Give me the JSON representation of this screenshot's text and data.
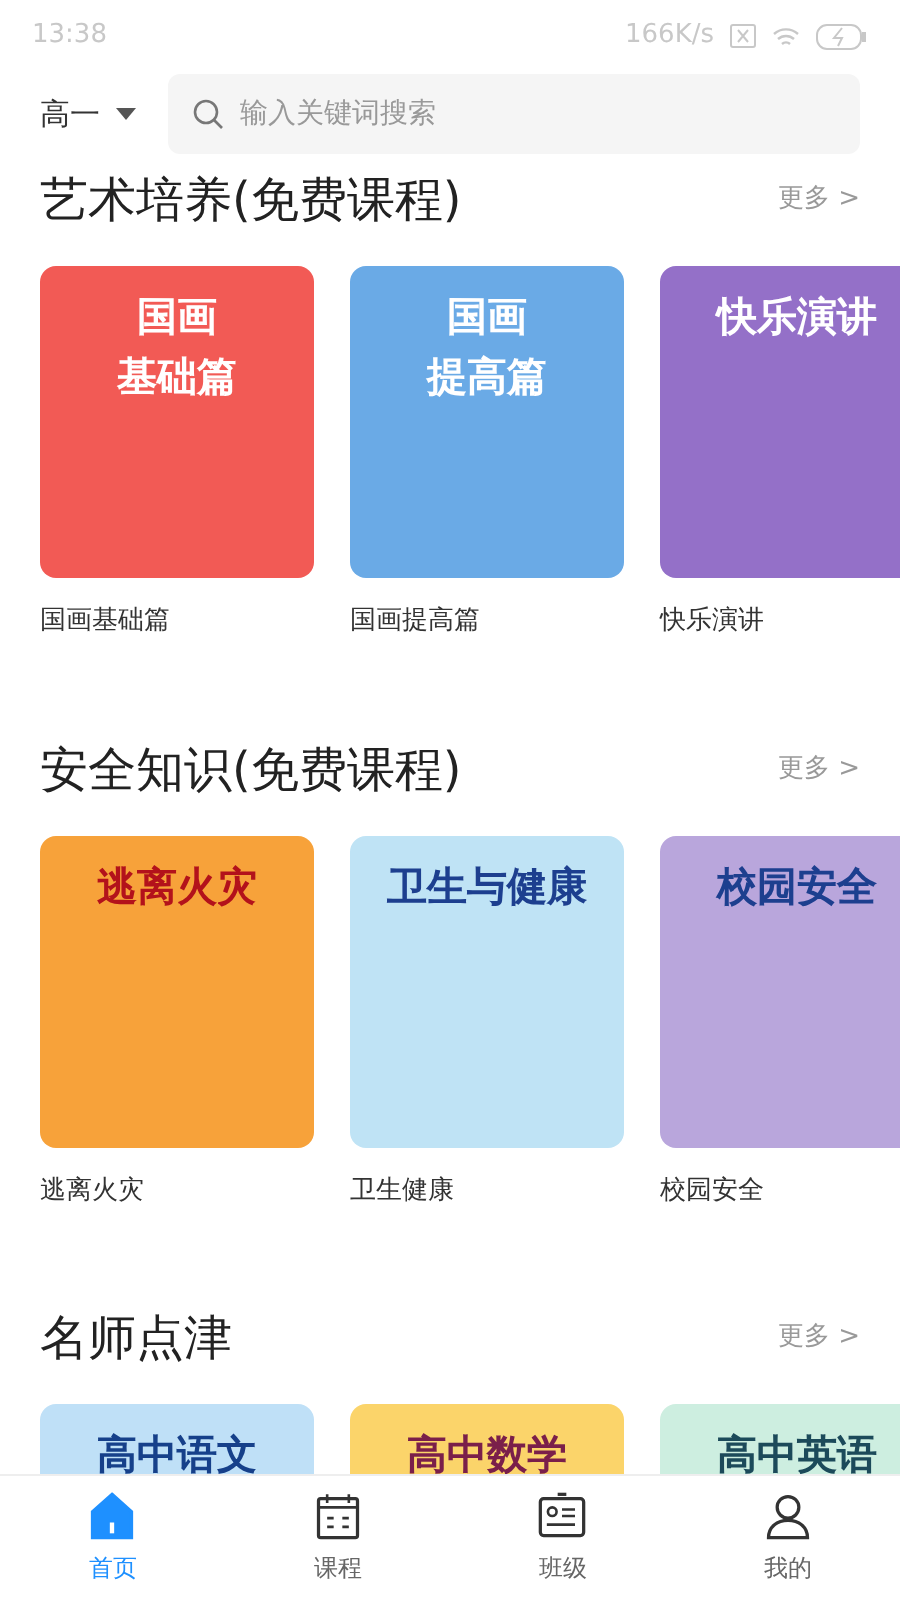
{
  "status_bar": {
    "time": "13:38",
    "speed": "166K/s"
  },
  "header": {
    "grade": "高一",
    "search": {
      "placeholder": "输入关键词搜索"
    }
  },
  "sections": [
    {
      "title": "艺术培养(免费课程)",
      "more": "更多 >",
      "courses": [
        {
          "cover_title": [
            "国画",
            "基础篇"
          ],
          "name": "国画基础篇"
        },
        {
          "cover_title": [
            "国画",
            "提高篇"
          ],
          "name": "国画提高篇"
        },
        {
          "cover_title": "快乐演讲",
          "name": "快乐演讲"
        }
      ]
    },
    {
      "title": "安全知识(免费课程)",
      "more": "更多 >",
      "courses": [
        {
          "cover_title": "逃离火灾",
          "name": "逃离火灾"
        },
        {
          "cover_title": "卫生与健康",
          "name": "卫生健康"
        },
        {
          "cover_title": "校园安全",
          "name": "校园安全"
        }
      ]
    },
    {
      "title": "名师点津",
      "more": "更多 >",
      "courses": [
        {
          "cover_title": "高中语文"
        },
        {
          "cover_title": "高中数学"
        },
        {
          "cover_title": "高中英语"
        }
      ]
    }
  ],
  "tabs": [
    {
      "label": "首页",
      "kind": "home",
      "selected": true
    },
    {
      "label": "课程",
      "kind": "calendar",
      "selected": false
    },
    {
      "label": "班级",
      "kind": "card",
      "selected": false
    },
    {
      "label": "我的",
      "kind": "user",
      "selected": false
    }
  ]
}
